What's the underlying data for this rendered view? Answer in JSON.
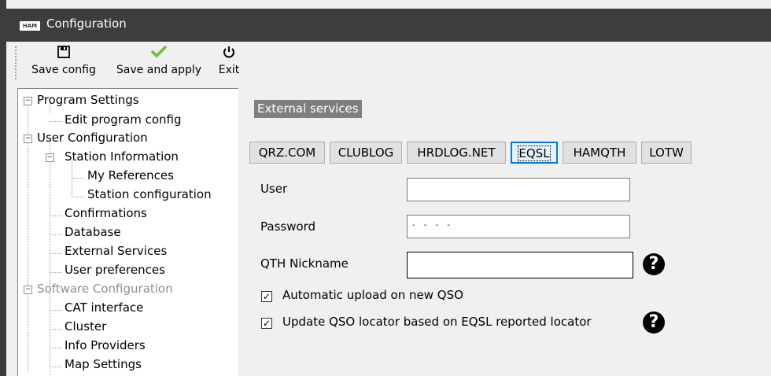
{
  "window": {
    "title": "Configuration",
    "logo_text": "HAM"
  },
  "toolbar": {
    "save_config": {
      "label": "Save config",
      "icon": "floppy-disk-icon"
    },
    "save_apply": {
      "label": "Save and apply",
      "icon": "checkmark-icon",
      "color": "#6cbf3a"
    },
    "exit": {
      "label": "Exit",
      "icon": "power-icon"
    }
  },
  "tree": {
    "items": [
      {
        "label": "Program Settings",
        "expanded": true
      },
      {
        "label": "Edit program config"
      },
      {
        "label": "User Configuration",
        "expanded": true
      },
      {
        "label": "Station Information",
        "expanded": true
      },
      {
        "label": "My References"
      },
      {
        "label": "Station configuration"
      },
      {
        "label": "Confirmations"
      },
      {
        "label": "Database"
      },
      {
        "label": "External Services"
      },
      {
        "label": "User preferences"
      },
      {
        "label": "Software Configuration",
        "expanded": true,
        "disabled": true
      },
      {
        "label": "CAT interface"
      },
      {
        "label": "Cluster"
      },
      {
        "label": "Info Providers"
      },
      {
        "label": "Map Settings"
      }
    ]
  },
  "panel": {
    "section_title": "External services",
    "tabs": [
      {
        "label": "QRZ.COM"
      },
      {
        "label": "CLUBLOG"
      },
      {
        "label": "HRDLOG.NET"
      },
      {
        "label": "EQSL",
        "active": true
      },
      {
        "label": "HAMQTH"
      },
      {
        "label": "LOTW"
      }
    ],
    "fields": {
      "user": {
        "label": "User",
        "value": ""
      },
      "password": {
        "label": "Password",
        "value": "- - - -"
      },
      "qth_nickname": {
        "label": "QTH Nickname",
        "value": ""
      }
    },
    "checkboxes": {
      "auto_upload": {
        "label": "Automatic upload on new QSO",
        "checked": true
      },
      "update_locator": {
        "label": "Update QSO locator based on EQSL reported locator",
        "checked": true
      }
    },
    "help_icon": "?"
  }
}
